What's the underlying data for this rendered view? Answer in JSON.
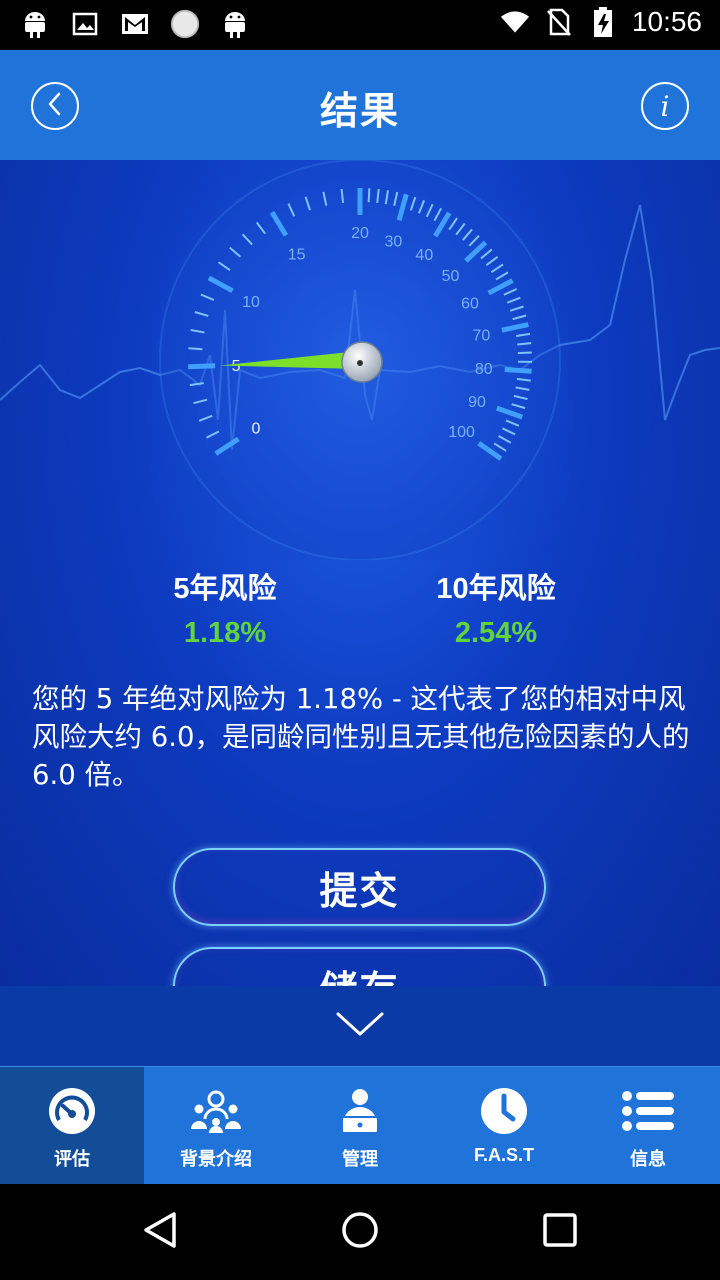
{
  "status_bar": {
    "time": "10:56",
    "icons": [
      "android-icon",
      "image-icon",
      "gmail-icon",
      "circle-icon",
      "android-icon",
      "wifi-icon",
      "no-sim-icon",
      "battery-charging-icon"
    ]
  },
  "header": {
    "title": "结果",
    "back_icon": "chevron-left-icon",
    "info_label": "i"
  },
  "gauge": {
    "ticks_left": [
      "0",
      "5",
      "10",
      "15"
    ],
    "ticks_right": [
      "20",
      "30",
      "40",
      "50",
      "60",
      "70",
      "80",
      "90",
      "100"
    ],
    "needle_value": 5.0
  },
  "risk": {
    "five_year": {
      "label": "5年风险",
      "value": "1.18%"
    },
    "ten_year": {
      "label": "10年风险",
      "value": "2.54%"
    }
  },
  "description": "您的 5 年绝对风险为 1.18% - 这代表了您的相对中风风险大约 6.0，是同龄同性别且无其他危险因素的人的 6.0 倍。",
  "buttons": {
    "submit": "提交",
    "save": "储存"
  },
  "tabs": [
    {
      "label": "评估",
      "icon": "gauge-icon",
      "active": true
    },
    {
      "label": "背景介绍",
      "icon": "people-icon",
      "active": false
    },
    {
      "label": "管理",
      "icon": "doctor-icon",
      "active": false
    },
    {
      "label": "F.A.S.T",
      "icon": "clock-icon",
      "active": false
    },
    {
      "label": "信息",
      "icon": "list-icon",
      "active": false
    }
  ],
  "colors": {
    "primary": "#1f73d9",
    "background": "#0d3bc0",
    "risk_value": "#63d33d",
    "needle": "#7ce02a"
  }
}
